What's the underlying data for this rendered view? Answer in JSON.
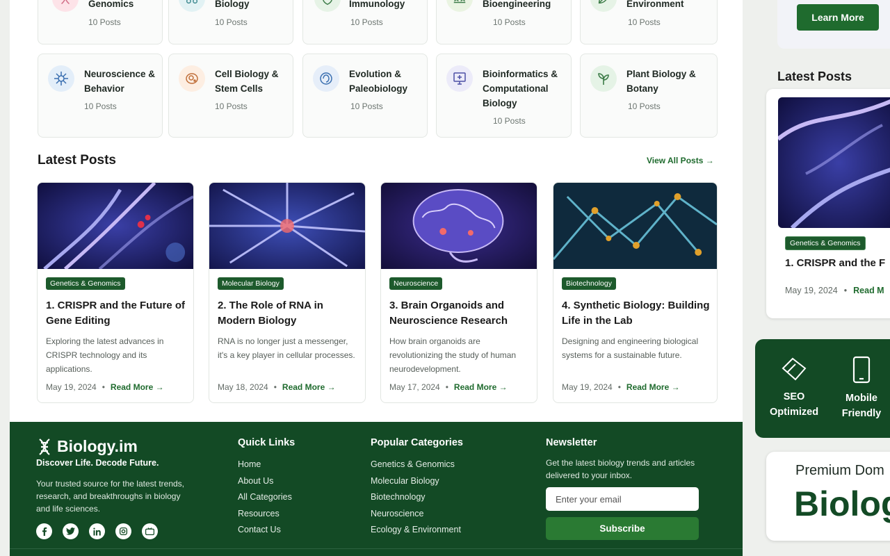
{
  "categories_top": [
    {
      "name": "Genomics",
      "count": "10 Posts",
      "color": "#fde3e8"
    },
    {
      "name": "Biology",
      "count": "10 Posts",
      "color": "#e2f2f4"
    },
    {
      "name": "Immunology",
      "count": "10 Posts",
      "color": "#e6f3e6"
    },
    {
      "name": "Bioengineering",
      "count": "10 Posts",
      "color": "#eaf4e2"
    },
    {
      "name": "Environment",
      "count": "10 Posts",
      "color": "#e6f3e6"
    }
  ],
  "categories": [
    {
      "name": "Neuroscience & Behavior",
      "count": "10 Posts",
      "icon": "neuron-icon",
      "color": "#e3eef9"
    },
    {
      "name": "Cell Biology & Stem Cells",
      "count": "10 Posts",
      "icon": "cell-icon",
      "color": "#fdeee2"
    },
    {
      "name": "Evolution & Paleobiology",
      "count": "10 Posts",
      "icon": "evolution-icon",
      "color": "#e6eef9"
    },
    {
      "name": "Bioinformatics & Computational Biology",
      "count": "10 Posts",
      "icon": "computer-icon",
      "color": "#ecebf9"
    },
    {
      "name": "Plant Biology & Botany",
      "count": "10 Posts",
      "icon": "plant-icon",
      "color": "#e5f3e6"
    }
  ],
  "latest": {
    "title": "Latest Posts",
    "view_all": "View All Posts →",
    "posts": [
      {
        "tag": "Genetics & Genomics",
        "title": "1. CRISPR and the Future of Gene Editing",
        "excerpt": "Exploring the latest advances in CRISPR technology and its applications.",
        "date": "May 19, 2024",
        "read_more": "Read More →"
      },
      {
        "tag": "Molecular Biology",
        "title": "2. The Role of RNA in Modern Biology",
        "excerpt": "RNA is no longer just a messenger, it's a key player in cellular processes.",
        "date": "May 18, 2024",
        "read_more": "Read More →"
      },
      {
        "tag": "Neuroscience",
        "title": "3. Brain Organoids and Neuroscience Research",
        "excerpt": "How brain organoids are revolutionizing the study of human neurodevelopment.",
        "date": "May 17, 2024",
        "read_more": "Read More →"
      },
      {
        "tag": "Biotechnology",
        "title": "4. Synthetic Biology: Building Life in the Lab",
        "excerpt": "Designing and engineering biological systems for a sustainable future.",
        "date": "May 19, 2024",
        "read_more": "Read More →"
      }
    ]
  },
  "footer": {
    "logo": "Biology.im",
    "tagline": "Discover Life. Decode Future.",
    "description": "Your trusted source for the latest trends, research, and breakthroughs in biology and life sciences.",
    "quick_links_title": "Quick Links",
    "quick_links": [
      "Home",
      "About Us",
      "All Categories",
      "Resources",
      "Contact Us"
    ],
    "popular_title": "Popular Categories",
    "popular": [
      "Genetics & Genomics",
      "Molecular Biology",
      "Biotechnology",
      "Neuroscience",
      "Ecology & Environment"
    ],
    "newsletter_title": "Newsletter",
    "newsletter_desc": "Get the latest biology trends and articles delivered to your inbox.",
    "email_placeholder": "Enter your email",
    "subscribe": "Subscribe",
    "social_icons": [
      "facebook-icon",
      "twitter-icon",
      "linkedin-icon",
      "instagram-icon",
      "youtube-icon"
    ]
  },
  "sidebar": {
    "learn_more": "Learn More",
    "latest_title": "Latest Posts",
    "post_tag": "Genetics & Genomics",
    "post_title": "1. CRISPR and the F",
    "post_date": "May 19, 2024",
    "post_read": "Read M",
    "features": [
      {
        "label1": "SEO",
        "label2": "Optimized",
        "icon": "seo-icon"
      },
      {
        "label1": "Mobile",
        "label2": "Friendly",
        "icon": "mobile-icon"
      }
    ],
    "premium_1": "Premium Dom",
    "premium_2": "Biolog"
  },
  "colors": {
    "brand": "#134a25",
    "accent": "#1f6b2e"
  }
}
